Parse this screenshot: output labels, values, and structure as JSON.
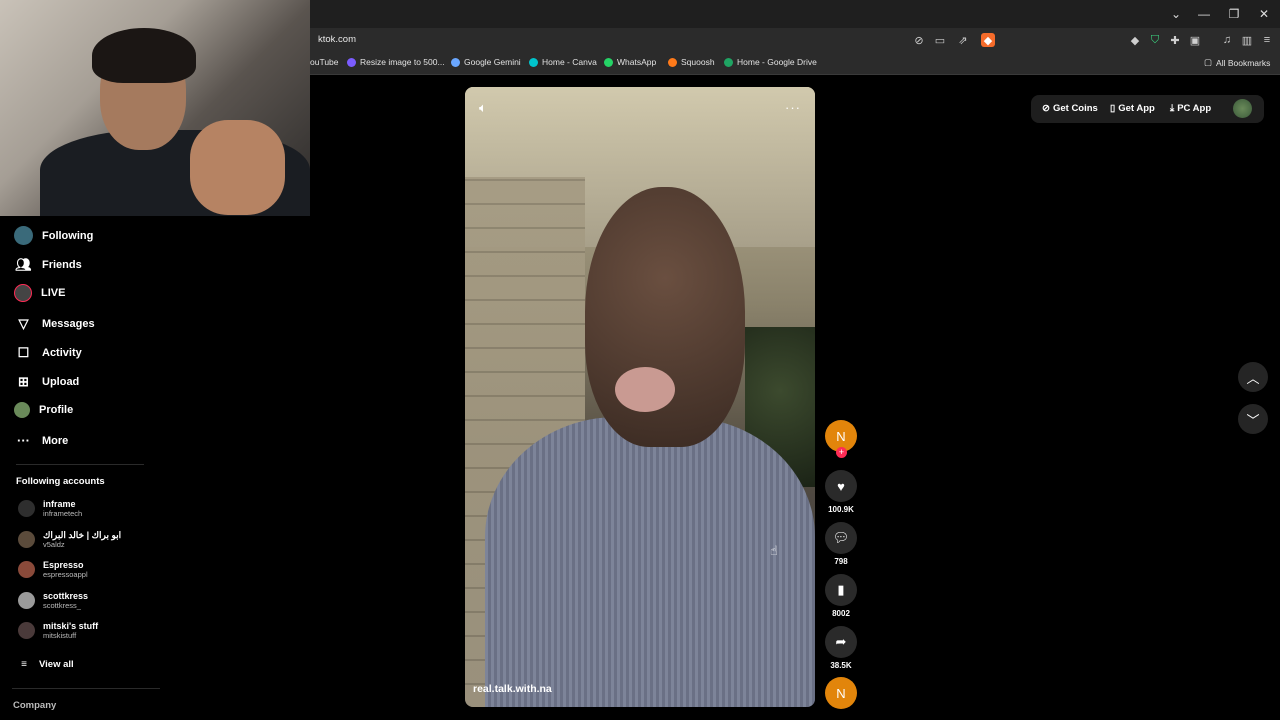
{
  "browser": {
    "url": "ktok.com",
    "bookmarks": [
      {
        "label": "ouTube",
        "color": "#e62117"
      },
      {
        "label": "Resize image to 500...",
        "color": "#7b5cff"
      },
      {
        "label": "Google Gemini",
        "color": "#6aa7ff"
      },
      {
        "label": "Home - Canva",
        "color": "#00c4cc"
      },
      {
        "label": "WhatsApp",
        "color": "#25d366"
      },
      {
        "label": "Squoosh",
        "color": "#ff7a1a"
      },
      {
        "label": "Home - Google Drive",
        "color": "#1fa463"
      }
    ],
    "all_bookmarks": "All Bookmarks"
  },
  "sidebar": {
    "nav": [
      {
        "label": "Following",
        "icon": "following-avatar-icon"
      },
      {
        "label": "Friends",
        "icon": "friends-icon"
      },
      {
        "label": "LIVE",
        "icon": "live-icon"
      },
      {
        "label": "Messages",
        "icon": "messages-icon"
      },
      {
        "label": "Activity",
        "icon": "activity-icon"
      },
      {
        "label": "Upload",
        "icon": "upload-icon"
      },
      {
        "label": "Profile",
        "icon": "profile-avatar-icon"
      },
      {
        "label": "More",
        "icon": "more-icon"
      }
    ],
    "following_title": "Following accounts",
    "accounts": [
      {
        "name": "inframe",
        "handle": "inframetech"
      },
      {
        "name": "ابو براك | خالد البراك",
        "handle": "v5aldz"
      },
      {
        "name": "Espresso",
        "handle": "espressoappl"
      },
      {
        "name": "scottkress",
        "handle": "scottkress_"
      },
      {
        "name": "mitski's stuff",
        "handle": "mitskistuff"
      }
    ],
    "view_all": "View all",
    "company": "Company"
  },
  "video": {
    "username": "real.talk.with.na",
    "author_initial": "N",
    "likes": "100.9K",
    "comments": "798",
    "saves": "8002",
    "shares": "38.5K"
  },
  "topbar": {
    "get_coins": "Get Coins",
    "get_app": "Get App",
    "pc_app": "PC App"
  }
}
